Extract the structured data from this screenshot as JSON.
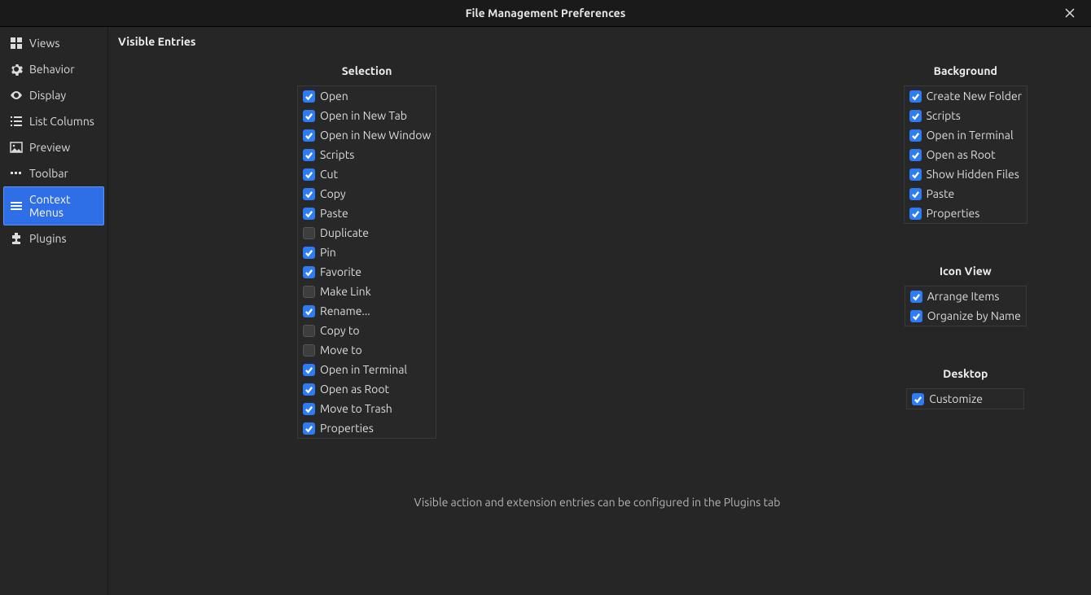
{
  "window": {
    "title": "File Management Preferences"
  },
  "sidebar": {
    "items": [
      {
        "id": "views",
        "label": "Views",
        "icon": "views",
        "selected": false
      },
      {
        "id": "behavior",
        "label": "Behavior",
        "icon": "gear",
        "selected": false
      },
      {
        "id": "display",
        "label": "Display",
        "icon": "eye",
        "selected": false
      },
      {
        "id": "list-columns",
        "label": "List Columns",
        "icon": "list",
        "selected": false
      },
      {
        "id": "preview",
        "label": "Preview",
        "icon": "image",
        "selected": false
      },
      {
        "id": "toolbar",
        "label": "Toolbar",
        "icon": "dots",
        "selected": false
      },
      {
        "id": "context-menus",
        "label": "Context Menus",
        "icon": "menu",
        "selected": true
      },
      {
        "id": "plugins",
        "label": "Plugins",
        "icon": "plugin",
        "selected": false
      }
    ]
  },
  "page": {
    "title": "Visible Entries",
    "footnote": "Visible action and extension entries can be configured in the Plugins tab"
  },
  "sections": {
    "selection": {
      "title": "Selection",
      "items": [
        {
          "label": "Open",
          "checked": true
        },
        {
          "label": "Open in New Tab",
          "checked": true
        },
        {
          "label": "Open in New Window",
          "checked": true
        },
        {
          "label": "Scripts",
          "checked": true
        },
        {
          "label": "Cut",
          "checked": true
        },
        {
          "label": "Copy",
          "checked": true
        },
        {
          "label": "Paste",
          "checked": true
        },
        {
          "label": "Duplicate",
          "checked": false
        },
        {
          "label": "Pin",
          "checked": true
        },
        {
          "label": "Favorite",
          "checked": true
        },
        {
          "label": "Make Link",
          "checked": false
        },
        {
          "label": "Rename...",
          "checked": true
        },
        {
          "label": "Copy to",
          "checked": false
        },
        {
          "label": "Move to",
          "checked": false
        },
        {
          "label": "Open in Terminal",
          "checked": true
        },
        {
          "label": "Open as Root",
          "checked": true
        },
        {
          "label": "Move to Trash",
          "checked": true
        },
        {
          "label": "Properties",
          "checked": true
        }
      ]
    },
    "background": {
      "title": "Background",
      "items": [
        {
          "label": "Create New Folder",
          "checked": true
        },
        {
          "label": "Scripts",
          "checked": true
        },
        {
          "label": "Open in Terminal",
          "checked": true
        },
        {
          "label": "Open as Root",
          "checked": true
        },
        {
          "label": "Show Hidden Files",
          "checked": true
        },
        {
          "label": "Paste",
          "checked": true
        },
        {
          "label": "Properties",
          "checked": true
        }
      ]
    },
    "iconview": {
      "title": "Icon View",
      "items": [
        {
          "label": "Arrange Items",
          "checked": true
        },
        {
          "label": "Organize by Name",
          "checked": true
        }
      ]
    },
    "desktop": {
      "title": "Desktop",
      "items": [
        {
          "label": "Customize",
          "checked": true
        }
      ]
    }
  }
}
